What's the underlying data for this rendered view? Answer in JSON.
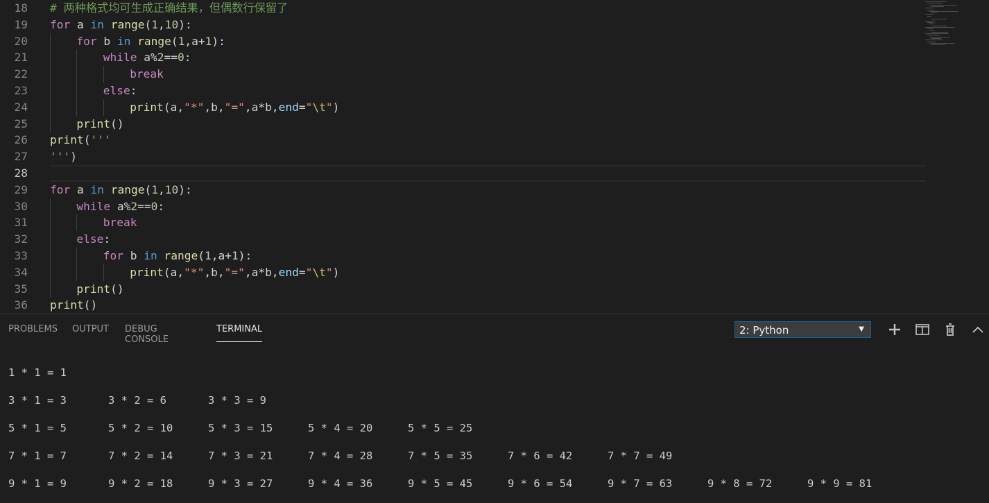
{
  "editor": {
    "lines": [
      {
        "n": "18",
        "tokens": [
          {
            "t": "# 两种格式均可生成正确结果，但偶数行保留了",
            "c": "cmt"
          }
        ],
        "indent": 0
      },
      {
        "n": "19",
        "tokens": [
          {
            "t": "for",
            "c": "kw"
          },
          {
            "t": " a ",
            "c": "plain"
          },
          {
            "t": "in",
            "c": "kw2"
          },
          {
            "t": " ",
            "c": "plain"
          },
          {
            "t": "range",
            "c": "fn"
          },
          {
            "t": "(",
            "c": "plain"
          },
          {
            "t": "1",
            "c": "num"
          },
          {
            "t": ",",
            "c": "plain"
          },
          {
            "t": "10",
            "c": "num"
          },
          {
            "t": "):",
            "c": "plain"
          }
        ],
        "indent": 0
      },
      {
        "n": "20",
        "tokens": [
          {
            "t": "for",
            "c": "kw"
          },
          {
            "t": " b ",
            "c": "plain"
          },
          {
            "t": "in",
            "c": "kw2"
          },
          {
            "t": " ",
            "c": "plain"
          },
          {
            "t": "range",
            "c": "fn"
          },
          {
            "t": "(",
            "c": "plain"
          },
          {
            "t": "1",
            "c": "num"
          },
          {
            "t": ",a+",
            "c": "plain"
          },
          {
            "t": "1",
            "c": "num"
          },
          {
            "t": "):",
            "c": "plain"
          }
        ],
        "indent": 1
      },
      {
        "n": "21",
        "tokens": [
          {
            "t": "while",
            "c": "kw"
          },
          {
            "t": " a%",
            "c": "plain"
          },
          {
            "t": "2",
            "c": "num"
          },
          {
            "t": "==",
            "c": "plain"
          },
          {
            "t": "0",
            "c": "num"
          },
          {
            "t": ":",
            "c": "plain"
          }
        ],
        "indent": 2
      },
      {
        "n": "22",
        "tokens": [
          {
            "t": "break",
            "c": "kw"
          }
        ],
        "indent": 3
      },
      {
        "n": "23",
        "tokens": [
          {
            "t": "else",
            "c": "kw"
          },
          {
            "t": ":",
            "c": "plain"
          }
        ],
        "indent": 2
      },
      {
        "n": "24",
        "tokens": [
          {
            "t": "print",
            "c": "fn"
          },
          {
            "t": "(a,",
            "c": "plain"
          },
          {
            "t": "\"*\"",
            "c": "str"
          },
          {
            "t": ",b,",
            "c": "plain"
          },
          {
            "t": "\"=\"",
            "c": "str"
          },
          {
            "t": ",a*b,",
            "c": "plain"
          },
          {
            "t": "end",
            "c": "par"
          },
          {
            "t": "=",
            "c": "plain"
          },
          {
            "t": "\"",
            "c": "str"
          },
          {
            "t": "\\t",
            "c": "esc"
          },
          {
            "t": "\"",
            "c": "str"
          },
          {
            "t": ")",
            "c": "plain"
          }
        ],
        "indent": 3
      },
      {
        "n": "25",
        "tokens": [
          {
            "t": "print",
            "c": "fn"
          },
          {
            "t": "()",
            "c": "plain"
          }
        ],
        "indent": 1
      },
      {
        "n": "26",
        "tokens": [
          {
            "t": "print",
            "c": "fn"
          },
          {
            "t": "(",
            "c": "plain"
          },
          {
            "t": "'''",
            "c": "str"
          }
        ],
        "indent": 0
      },
      {
        "n": "27",
        "tokens": [
          {
            "t": "'''",
            "c": "str"
          },
          {
            "t": ")",
            "c": "plain"
          }
        ],
        "indent": 0
      },
      {
        "n": "28",
        "tokens": [],
        "indent": 0,
        "current": true
      },
      {
        "n": "29",
        "tokens": [
          {
            "t": "for",
            "c": "kw"
          },
          {
            "t": " a ",
            "c": "plain"
          },
          {
            "t": "in",
            "c": "kw2"
          },
          {
            "t": " ",
            "c": "plain"
          },
          {
            "t": "range",
            "c": "fn"
          },
          {
            "t": "(",
            "c": "plain"
          },
          {
            "t": "1",
            "c": "num"
          },
          {
            "t": ",",
            "c": "plain"
          },
          {
            "t": "10",
            "c": "num"
          },
          {
            "t": "):",
            "c": "plain"
          }
        ],
        "indent": 0
      },
      {
        "n": "30",
        "tokens": [
          {
            "t": "while",
            "c": "kw"
          },
          {
            "t": " a%",
            "c": "plain"
          },
          {
            "t": "2",
            "c": "num"
          },
          {
            "t": "==",
            "c": "plain"
          },
          {
            "t": "0",
            "c": "num"
          },
          {
            "t": ":",
            "c": "plain"
          }
        ],
        "indent": 1
      },
      {
        "n": "31",
        "tokens": [
          {
            "t": "break",
            "c": "kw"
          }
        ],
        "indent": 2
      },
      {
        "n": "32",
        "tokens": [
          {
            "t": "else",
            "c": "kw"
          },
          {
            "t": ":",
            "c": "plain"
          }
        ],
        "indent": 1
      },
      {
        "n": "33",
        "tokens": [
          {
            "t": "for",
            "c": "kw"
          },
          {
            "t": " b ",
            "c": "plain"
          },
          {
            "t": "in",
            "c": "kw2"
          },
          {
            "t": " ",
            "c": "plain"
          },
          {
            "t": "range",
            "c": "fn"
          },
          {
            "t": "(",
            "c": "plain"
          },
          {
            "t": "1",
            "c": "num"
          },
          {
            "t": ",a+",
            "c": "plain"
          },
          {
            "t": "1",
            "c": "num"
          },
          {
            "t": "):",
            "c": "plain"
          }
        ],
        "indent": 2
      },
      {
        "n": "34",
        "tokens": [
          {
            "t": "print",
            "c": "fn"
          },
          {
            "t": "(a,",
            "c": "plain"
          },
          {
            "t": "\"*\"",
            "c": "str"
          },
          {
            "t": ",b,",
            "c": "plain"
          },
          {
            "t": "\"=\"",
            "c": "str"
          },
          {
            "t": ",a*b,",
            "c": "plain"
          },
          {
            "t": "end",
            "c": "par"
          },
          {
            "t": "=",
            "c": "plain"
          },
          {
            "t": "\"",
            "c": "str"
          },
          {
            "t": "\\t",
            "c": "esc"
          },
          {
            "t": "\"",
            "c": "str"
          },
          {
            "t": ")",
            "c": "plain"
          }
        ],
        "indent": 3
      },
      {
        "n": "35",
        "tokens": [
          {
            "t": "print",
            "c": "fn"
          },
          {
            "t": "()",
            "c": "plain"
          }
        ],
        "indent": 1
      },
      {
        "n": "36",
        "tokens": [
          {
            "t": "print",
            "c": "fn"
          },
          {
            "t": "()",
            "c": "plain"
          }
        ],
        "indent": 0
      }
    ]
  },
  "panel": {
    "tabs": [
      {
        "label": "PROBLEMS",
        "active": false
      },
      {
        "label": "OUTPUT",
        "active": false
      },
      {
        "label": "DEBUG CONSOLE",
        "active": false
      },
      {
        "label": "TERMINAL",
        "active": true
      }
    ],
    "terminal_select": {
      "value": "2: Python",
      "arrow": "▼"
    },
    "icons": [
      "plus-icon",
      "split-icon",
      "trash-icon",
      "chevron-up-icon"
    ]
  },
  "terminal": {
    "rows": [
      [
        "1 * 1 = 1"
      ],
      [
        "3 * 1 = 3",
        "3 * 2 = 6",
        "3 * 3 = 9"
      ],
      [
        "5 * 1 = 5",
        "5 * 2 = 10",
        "5 * 3 = 15",
        "5 * 4 = 20",
        "5 * 5 = 25"
      ],
      [
        "7 * 1 = 7",
        "7 * 2 = 14",
        "7 * 3 = 21",
        "7 * 4 = 28",
        "7 * 5 = 35",
        "7 * 6 = 42",
        "7 * 7 = 49"
      ],
      [
        "9 * 1 = 9",
        "9 * 2 = 18",
        "9 * 3 = 27",
        "9 * 4 = 36",
        "9 * 5 = 45",
        "9 * 6 = 54",
        "9 * 7 = 63",
        "9 * 8 = 72",
        "9 * 9 = 81"
      ]
    ]
  }
}
